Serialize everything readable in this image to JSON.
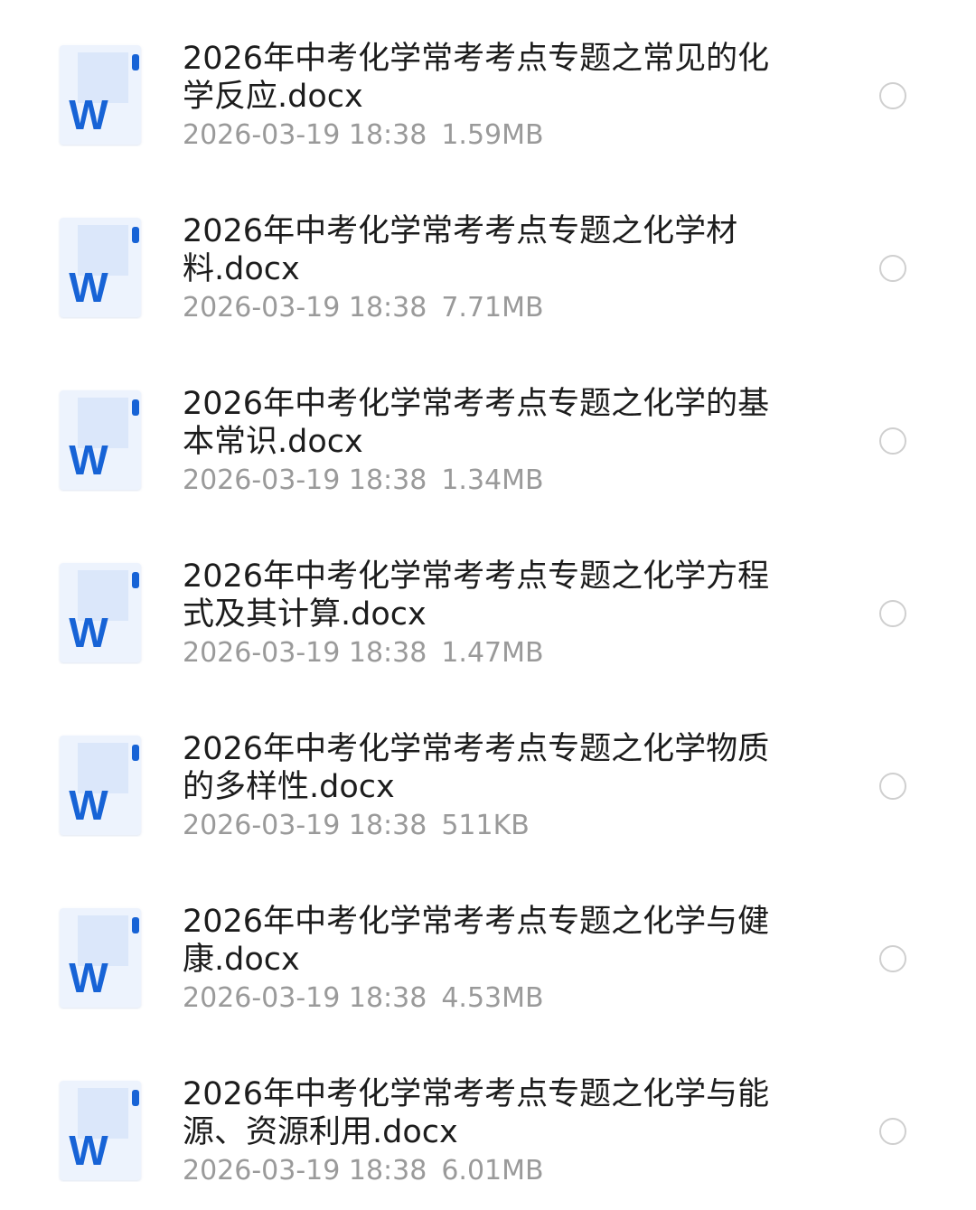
{
  "colors": {
    "title_text": "#1c1c1c",
    "meta_text": "#9a9a9a",
    "radio_border": "#cfcfcf",
    "word_blue": "#1763d6",
    "doc_page_light": "#edf3fd",
    "doc_page_mid": "#dbe7fa"
  },
  "files": [
    {
      "name": "2026年中考化学常考考点专题之常见的化学反应.docx",
      "date": "2026-03-19 18:38",
      "size": "1.59MB",
      "icon": "word-doc-icon"
    },
    {
      "name": "2026年中考化学常考考点专题之化学材料.docx",
      "date": "2026-03-19 18:38",
      "size": "7.71MB",
      "icon": "word-doc-icon"
    },
    {
      "name": "2026年中考化学常考考点专题之化学的基本常识.docx",
      "date": "2026-03-19 18:38",
      "size": "1.34MB",
      "icon": "word-doc-icon"
    },
    {
      "name": "2026年中考化学常考考点专题之化学方程式及其计算.docx",
      "date": "2026-03-19 18:38",
      "size": "1.47MB",
      "icon": "word-doc-icon"
    },
    {
      "name": "2026年中考化学常考考点专题之化学物质的多样性.docx",
      "date": "2026-03-19 18:38",
      "size": "511KB",
      "icon": "word-doc-icon"
    },
    {
      "name": "2026年中考化学常考考点专题之化学与健康.docx",
      "date": "2026-03-19 18:38",
      "size": "4.53MB",
      "icon": "word-doc-icon"
    },
    {
      "name": "2026年中考化学常考考点专题之化学与能源、资源利用.docx",
      "date": "2026-03-19 18:38",
      "size": "6.01MB",
      "icon": "word-doc-icon"
    }
  ]
}
